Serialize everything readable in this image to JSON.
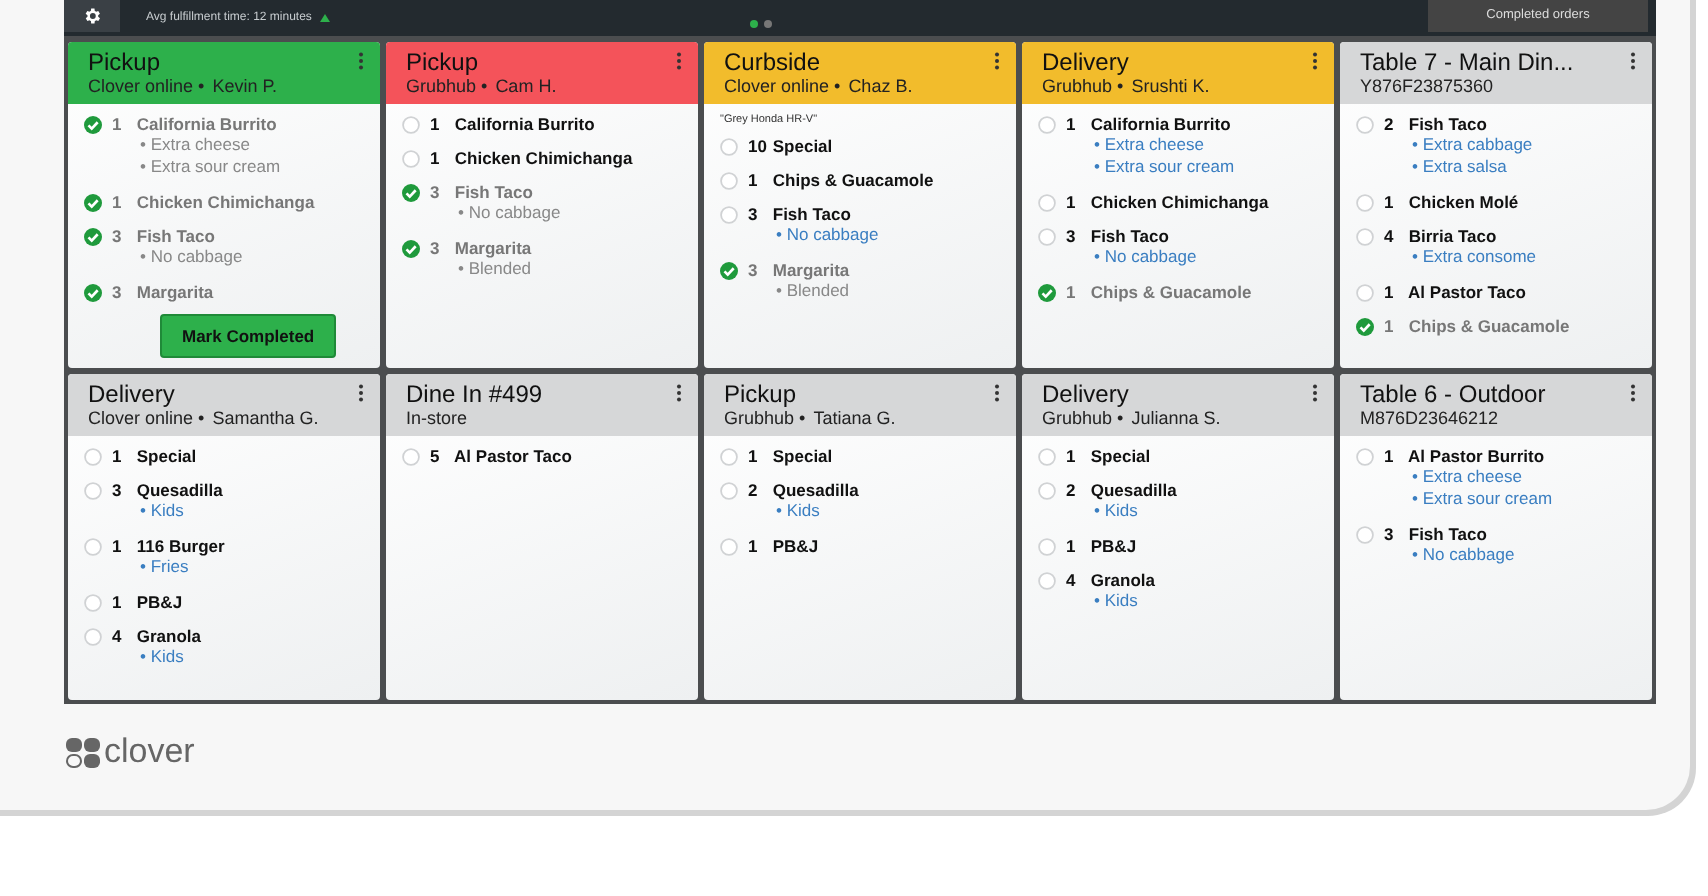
{
  "top_bar": {
    "subtitle": "Avg fulfillment time: 12 minutes",
    "pages": [
      {
        "selected": true
      },
      {
        "selected": false
      }
    ],
    "completed_button": "Completed orders"
  },
  "tickets": [
    {
      "title": "Pickup",
      "color": "#2db04b",
      "source": "Clover online •",
      "customer": "Kevin P.",
      "items": [
        {
          "qty": "1",
          "name": "California Burrito",
          "checked": true,
          "modifiers": [
            "• Extra cheese",
            "• Extra sour cream"
          ]
        },
        {
          "qty": "1",
          "name": "Chicken Chimichanga",
          "checked": true
        },
        {
          "qty": "3",
          "name": "Fish Taco",
          "checked": true,
          "modifiers": [
            "• No cabbage"
          ]
        },
        {
          "qty": "3",
          "name": "Margarita",
          "checked": true
        }
      ],
      "action": "Mark Completed"
    },
    {
      "title": "Pickup",
      "color": "#f4535a",
      "source": "Grubhub •",
      "customer": "Cam H.",
      "items": [
        {
          "qty": "1",
          "name": "California Burrito",
          "checked": false
        },
        {
          "qty": "1",
          "name": "Chicken Chimichanga",
          "checked": false
        },
        {
          "qty": "3",
          "name": "Fish Taco",
          "checked": true,
          "modifiers": [
            "• No cabbage"
          ]
        },
        {
          "qty": "3",
          "name": "Margarita",
          "checked": true,
          "modifiers": [
            "• Blended"
          ]
        }
      ]
    },
    {
      "title": "Curbside",
      "color": "#f2bc2c",
      "source": "Clover online •",
      "customer": "Chaz B.",
      "note": "\"Grey Honda HR-V\"",
      "items": [
        {
          "qty": "10",
          "name": "Special",
          "checked": false
        },
        {
          "qty": "1",
          "name": "Chips & Guacamole",
          "checked": false
        },
        {
          "qty": "3",
          "name": "Fish Taco",
          "checked": false,
          "modifiers": [
            "• No cabbage"
          ]
        },
        {
          "qty": "3",
          "name": "Margarita",
          "checked": true,
          "modifiers": [
            "• Blended"
          ]
        }
      ]
    },
    {
      "title": "Delivery",
      "color": "#f2bc2c",
      "source": "Grubhub •",
      "customer": "Srushti K.",
      "items": [
        {
          "qty": "1",
          "name": "California Burrito",
          "checked": false,
          "modifiers": [
            "• Extra cheese",
            "• Extra sour cream"
          ]
        },
        {
          "qty": "1",
          "name": "Chicken Chimichanga",
          "checked": false
        },
        {
          "qty": "3",
          "name": "Fish Taco",
          "checked": false,
          "modifiers": [
            "• No cabbage"
          ]
        },
        {
          "qty": "1",
          "name": "Chips & Guacamole",
          "checked": true
        }
      ]
    },
    {
      "title": "Table 7 - Main Din...",
      "color": "#d6d7d8",
      "source": "Y876F23875360",
      "items": [
        {
          "qty": "2",
          "name": "Fish Taco",
          "checked": false,
          "modifiers": [
            "• Extra cabbage",
            "• Extra salsa"
          ]
        },
        {
          "qty": "1",
          "name": "Chicken Molé",
          "checked": false
        },
        {
          "qty": "4",
          "name": "Birria Taco",
          "checked": false,
          "modifiers": [
            "• Extra consome"
          ]
        },
        {
          "qty": "1",
          "name": "Al Pastor Taco",
          "checked": false
        },
        {
          "qty": "1",
          "name": "Chips & Guacamole",
          "checked": true
        }
      ]
    },
    {
      "title": "Delivery",
      "color": "#d6d7d8",
      "source": "Clover online •",
      "customer": "Samantha G.",
      "items": [
        {
          "qty": "1",
          "name": "Special",
          "checked": false
        },
        {
          "qty": "3",
          "name": "Quesadilla",
          "checked": false,
          "modifiers": [
            "• Kids"
          ]
        },
        {
          "qty": "1",
          "name": "116 Burger",
          "checked": false,
          "modifiers": [
            "• Fries"
          ]
        },
        {
          "qty": "1",
          "name": "PB&J",
          "checked": false
        },
        {
          "qty": "4",
          "name": "Granola",
          "checked": false,
          "modifiers": [
            "• Kids"
          ]
        }
      ]
    },
    {
      "title": "Dine In #499",
      "color": "#d6d7d8",
      "source": "In-store",
      "items": [
        {
          "qty": "5",
          "name": "Al Pastor Taco",
          "checked": false
        }
      ]
    },
    {
      "title": "Pickup",
      "color": "#d6d7d8",
      "source": "Grubhub •",
      "customer": "Tatiana G.",
      "items": [
        {
          "qty": "1",
          "name": "Special",
          "checked": false
        },
        {
          "qty": "2",
          "name": "Quesadilla",
          "checked": false,
          "modifiers": [
            "• Kids"
          ]
        },
        {
          "qty": "1",
          "name": "PB&J",
          "checked": false
        }
      ]
    },
    {
      "title": "Delivery",
      "color": "#d6d7d8",
      "source": "Grubhub •",
      "customer": "Julianna S.",
      "items": [
        {
          "qty": "1",
          "name": "Special",
          "checked": false
        },
        {
          "qty": "2",
          "name": "Quesadilla",
          "checked": false,
          "modifiers": [
            "• Kids"
          ]
        },
        {
          "qty": "1",
          "name": "PB&J",
          "checked": false
        },
        {
          "qty": "4",
          "name": "Granola",
          "checked": false,
          "modifiers": [
            "• Kids"
          ]
        }
      ]
    },
    {
      "title": "Table 6 - Outdoor",
      "color": "#d6d7d8",
      "source": "M876D23646212",
      "items": [
        {
          "qty": "1",
          "name": "Al Pastor Burrito",
          "checked": false,
          "modifiers": [
            "• Extra cheese",
            "• Extra sour cream"
          ]
        },
        {
          "qty": "3",
          "name": "Fish Taco",
          "checked": false,
          "modifiers": [
            "• No cabbage"
          ]
        }
      ]
    }
  ],
  "brand": "clover"
}
